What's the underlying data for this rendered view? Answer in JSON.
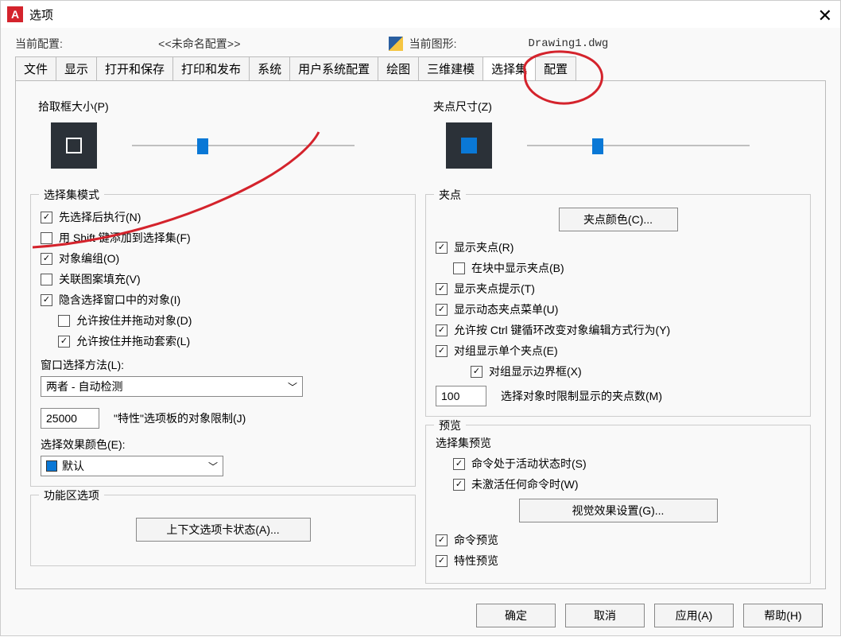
{
  "title": "选项",
  "current_config_label": "当前配置:",
  "current_config_value": "<<未命名配置>>",
  "current_drawing_label": "当前图形:",
  "current_drawing_value": "Drawing1.dwg",
  "tabs": [
    "文件",
    "显示",
    "打开和保存",
    "打印和发布",
    "系统",
    "用户系统配置",
    "绘图",
    "三维建模",
    "选择集",
    "配置"
  ],
  "active_tab_index": 8,
  "left": {
    "pickbox_title": "拾取框大小(P)",
    "mode_title": "选择集模式",
    "mode_checks": [
      {
        "label": "先选择后执行(N)",
        "checked": true,
        "indent": 0
      },
      {
        "label": "用 Shift 键添加到选择集(F)",
        "checked": false,
        "indent": 0
      },
      {
        "label": "对象编组(O)",
        "checked": true,
        "indent": 0
      },
      {
        "label": "关联图案填充(V)",
        "checked": false,
        "indent": 0
      },
      {
        "label": "隐含选择窗口中的对象(I)",
        "checked": true,
        "indent": 0
      },
      {
        "label": "允许按住并拖动对象(D)",
        "checked": false,
        "indent": 1
      },
      {
        "label": "允许按住并拖动套索(L)",
        "checked": true,
        "indent": 1
      }
    ],
    "window_method_label": "窗口选择方法(L):",
    "window_method_value": "两者 - 自动检测",
    "prop_limit_value": "25000",
    "prop_limit_label": "\"特性\"选项板的对象限制(J)",
    "effect_color_label": "选择效果颜色(E):",
    "effect_color_value": "默认",
    "ribbon_title": "功能区选项",
    "context_tab_btn": "上下文选项卡状态(A)..."
  },
  "right": {
    "gripsize_title": "夹点尺寸(Z)",
    "grips_title": "夹点",
    "grip_color_btn": "夹点颜色(C)...",
    "grip_checks": [
      {
        "label": "显示夹点(R)",
        "checked": true,
        "indent": 0
      },
      {
        "label": "在块中显示夹点(B)",
        "checked": false,
        "indent": 1
      },
      {
        "label": "显示夹点提示(T)",
        "checked": true,
        "indent": 0
      },
      {
        "label": "显示动态夹点菜单(U)",
        "checked": true,
        "indent": 0
      },
      {
        "label": "允许按 Ctrl 键循环改变对象编辑方式行为(Y)",
        "checked": true,
        "indent": 0
      },
      {
        "label": "对组显示单个夹点(E)",
        "checked": true,
        "indent": 0
      },
      {
        "label": "对组显示边界框(X)",
        "checked": true,
        "indent": 2
      }
    ],
    "grip_limit_value": "100",
    "grip_limit_label": "选择对象时限制显示的夹点数(M)",
    "preview_title": "预览",
    "preview_sub": "选择集预览",
    "preview_checks": [
      {
        "label": "命令处于活动状态时(S)",
        "checked": true,
        "indent": 1
      },
      {
        "label": "未激活任何命令时(W)",
        "checked": true,
        "indent": 1
      }
    ],
    "visual_btn": "视觉效果设置(G)...",
    "bottom_checks": [
      {
        "label": "命令预览",
        "checked": true
      },
      {
        "label": "特性预览",
        "checked": true
      }
    ]
  },
  "footer": {
    "ok": "确定",
    "cancel": "取消",
    "apply": "应用(A)",
    "help": "帮助(H)"
  }
}
